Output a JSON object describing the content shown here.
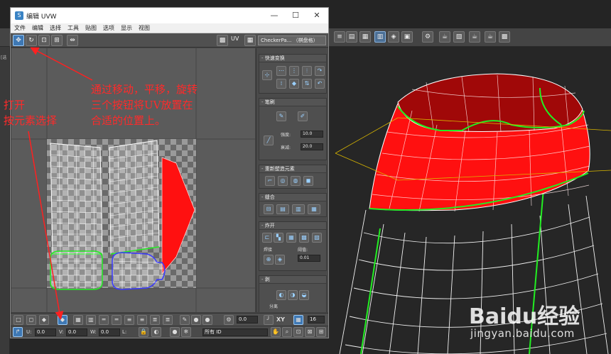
{
  "window": {
    "title": "编辑 UVW",
    "icon_letter": "S",
    "menu": [
      "文件",
      "编辑",
      "选择",
      "工具",
      "贴图",
      "选项",
      "显示",
      "视图"
    ],
    "texture_dropdown": "CheckerPa... （棋盘格）",
    "uv_space": "UV"
  },
  "left_strip": {
    "label": "[选"
  },
  "rollouts": {
    "quick_transform": "快速变换",
    "reshape": "重塑元素",
    "paint": "笔刷",
    "strength_label": "强度:",
    "strength_value": "10.0",
    "falloff_label": "衰减:",
    "falloff_value": "20.0",
    "relax_group": "重新塑造元素",
    "stitch": "缝合",
    "explode": "炸开",
    "weld_label": "焊接",
    "threshold_label": "阈值:",
    "threshold_value": "0.01",
    "peel": "剥",
    "split_label": "分离"
  },
  "bottom1": {
    "angle_value": "0.0",
    "xy_label": "XY",
    "grid_value": "16"
  },
  "bottom2": {
    "u_label": "U:",
    "u_value": "0.0",
    "v_label": "V:",
    "v_value": "0.0",
    "w_label": "W:",
    "w_value": "0.0",
    "l_label": "L:",
    "id_dropdown": "所有 ID"
  },
  "annotations": {
    "move_hint_1": "通过移动，平移，旋转",
    "move_hint_2": "三个按钮将UV放置在",
    "move_hint_3": "合适的位置上。",
    "open_hint_1": "打开",
    "open_hint_2": "按元素选择",
    "color": "#ff2020"
  },
  "watermark": {
    "logo": "Baidu经验",
    "url": "jingyan.baidu.com"
  },
  "colors": {
    "selected_faces": "#ff1010",
    "seam_green": "#22ee22",
    "seam_blue": "#3a3aff",
    "tool_active": "#3e78b4"
  }
}
